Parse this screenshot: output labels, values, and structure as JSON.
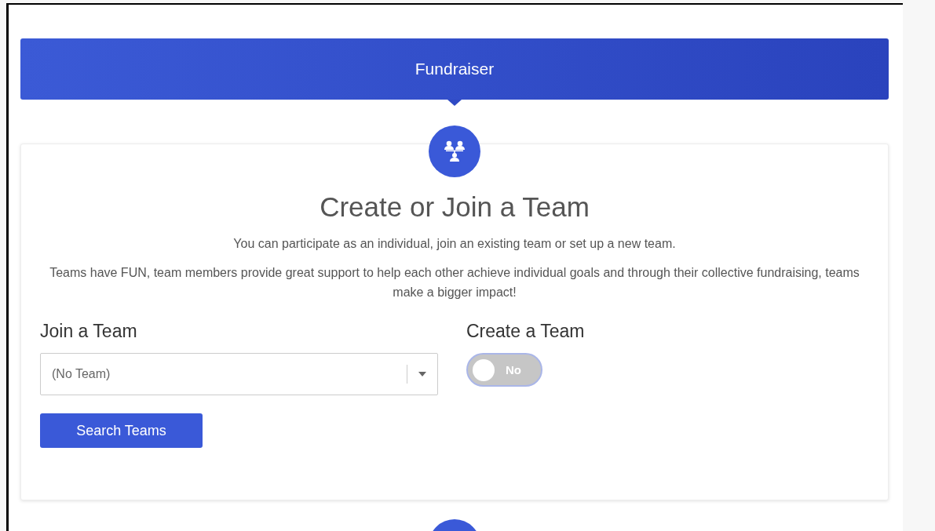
{
  "banner": {
    "title": "Fundraiser"
  },
  "team_section": {
    "title": "Create or Join a Team",
    "paragraphs": [
      "You can participate as an individual, join an existing team or set up a new team.",
      "Teams have FUN, team members provide great support to help each other achieve individual goals and through their collective fundraising, teams make a bigger impact!"
    ],
    "join": {
      "heading": "Join a Team",
      "select_value": "(No Team)",
      "button": "Search Teams"
    },
    "create": {
      "heading": "Create a Team",
      "toggle": {
        "on": false,
        "label": "No"
      }
    }
  }
}
